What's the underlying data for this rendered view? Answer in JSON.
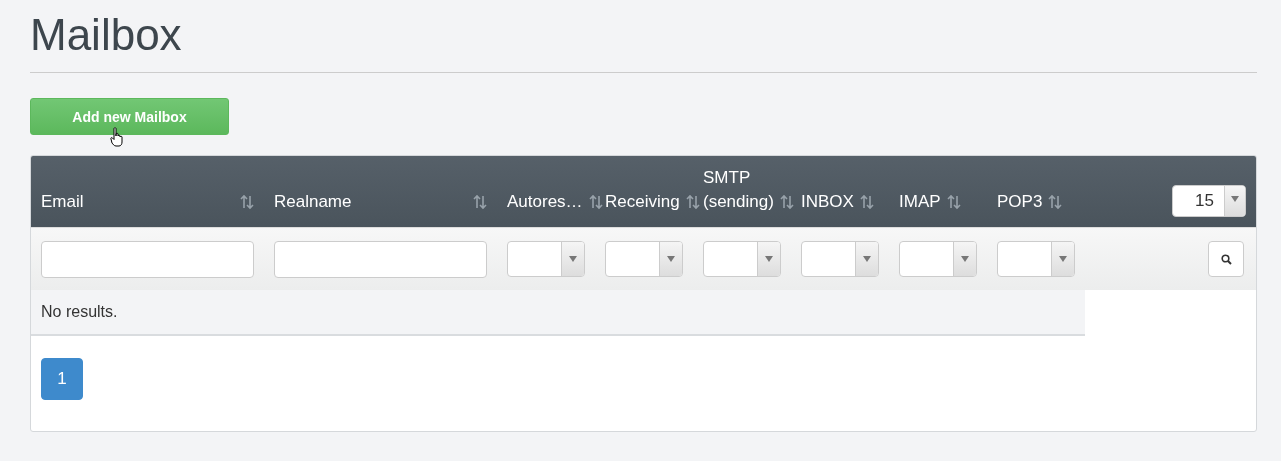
{
  "page": {
    "title": "Mailbox"
  },
  "add_button": {
    "label": "Add new Mailbox"
  },
  "table": {
    "columns": [
      {
        "label": "Email",
        "sortable": true
      },
      {
        "label": "Realname",
        "sortable": true
      },
      {
        "label": "Autores…",
        "sortable": true
      },
      {
        "label": "Receiving",
        "sortable": true
      },
      {
        "label": "SMTP (sending)",
        "sortable": true
      },
      {
        "label": "INBOX",
        "sortable": true
      },
      {
        "label": "IMAP",
        "sortable": true
      },
      {
        "label": "POP3",
        "sortable": true
      }
    ],
    "filters": [
      {
        "kind": "text"
      },
      {
        "kind": "text"
      },
      {
        "kind": "select"
      },
      {
        "kind": "select"
      },
      {
        "kind": "select"
      },
      {
        "kind": "select"
      },
      {
        "kind": "select"
      },
      {
        "kind": "select"
      },
      {
        "kind": "search"
      }
    ],
    "page_size": "15",
    "empty_message": "No results."
  },
  "pagination": [
    {
      "label": "1",
      "selected": true
    }
  ]
}
